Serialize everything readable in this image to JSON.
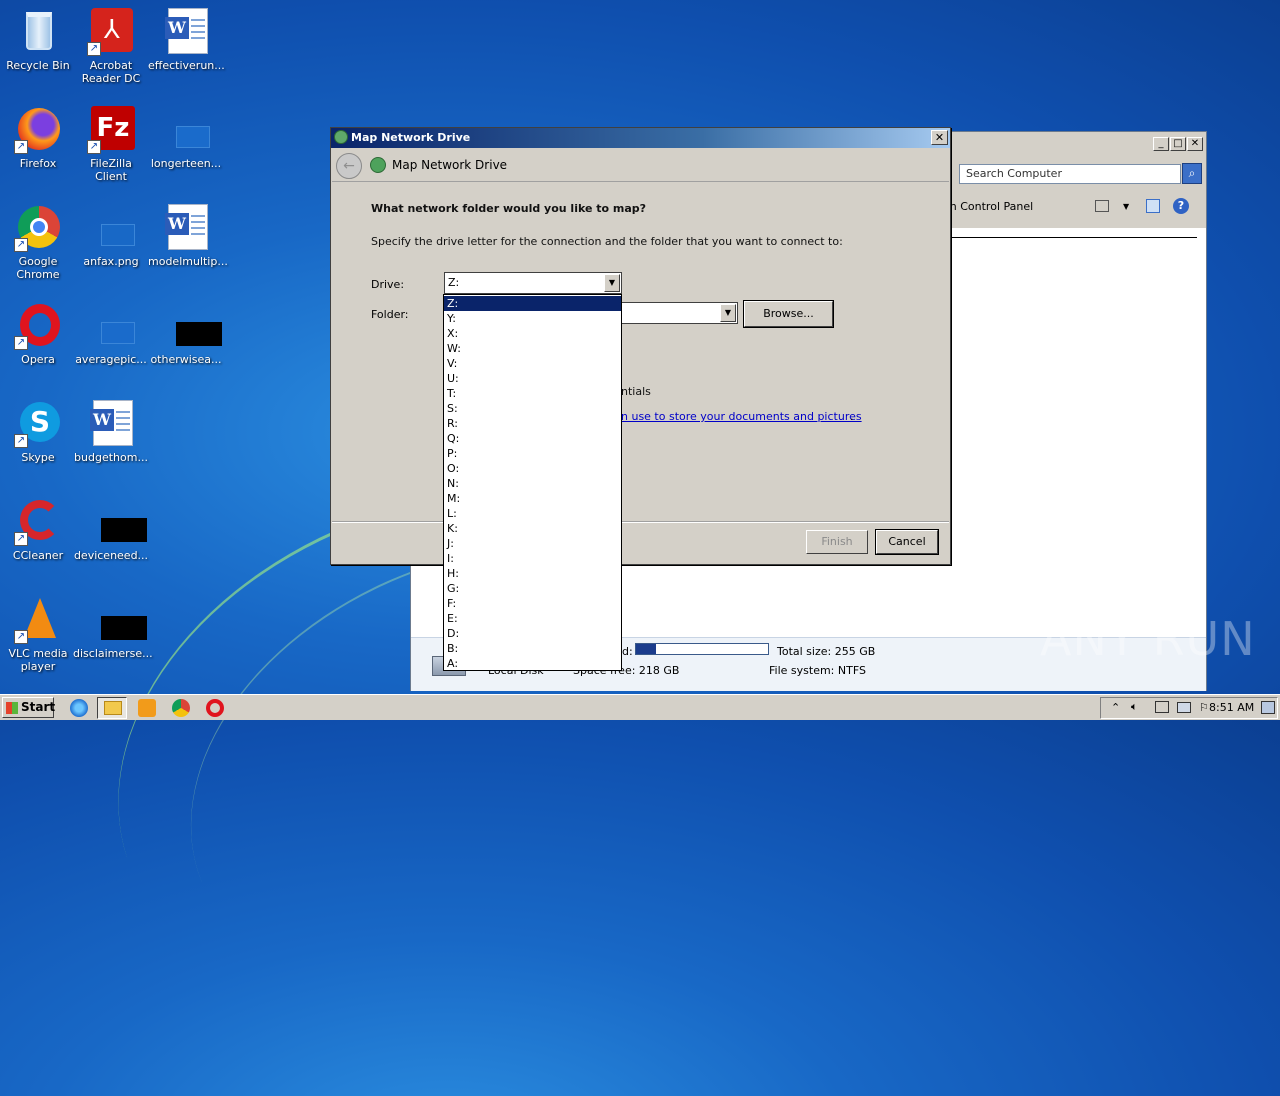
{
  "desktop": {
    "icons": [
      {
        "label": "Recycle Bin"
      },
      {
        "label": "Acrobat Reader DC"
      },
      {
        "label": "effectiverun..."
      },
      {
        "label": "Firefox"
      },
      {
        "label": "FileZilla Client"
      },
      {
        "label": "longerteen..."
      },
      {
        "label": "Google Chrome"
      },
      {
        "label": "anfax.png"
      },
      {
        "label": "modelmultip..."
      },
      {
        "label": "Opera"
      },
      {
        "label": "averagepic..."
      },
      {
        "label": "otherwisea..."
      },
      {
        "label": "Skype"
      },
      {
        "label": "budgethom..."
      },
      {
        "label": "CCleaner"
      },
      {
        "label": "deviceneed..."
      },
      {
        "label": "VLC media player"
      },
      {
        "label": "disclaimerse..."
      }
    ]
  },
  "explorer": {
    "search_placeholder": "Search Computer",
    "toolbar_partial": "en Control Panel",
    "details": {
      "space_used_label": "d:",
      "total_size": "Total size: 255 GB",
      "space_free": "Space free: 218 GB",
      "file_system": "File system: NTFS",
      "disk_label": "Local Disk",
      "used_fraction": 0.15
    }
  },
  "dialog": {
    "window_title": "Map Network Drive",
    "header_title": "Map Network Drive",
    "question": "What network folder would you like to map?",
    "instruction": "Specify the drive letter for the connection and the folder that you want to connect to:",
    "drive_label": "Drive:",
    "drive_value": "Z:",
    "folder_label": "Folder:",
    "browse_label": "Browse...",
    "credentials_partial": "ntials",
    "link_partial": "n use to store your documents and pictures",
    "finish_label": "Finish",
    "cancel_label": "Cancel",
    "drive_options": [
      "Z:",
      "Y:",
      "X:",
      "W:",
      "V:",
      "U:",
      "T:",
      "S:",
      "R:",
      "Q:",
      "P:",
      "O:",
      "N:",
      "M:",
      "L:",
      "K:",
      "J:",
      "I:",
      "H:",
      "G:",
      "F:",
      "E:",
      "D:",
      "B:",
      "A:"
    ],
    "selected_option": "Z:"
  },
  "taskbar": {
    "start_label": "Start",
    "clock": "8:51 AM"
  },
  "watermark": "ANY RUN"
}
